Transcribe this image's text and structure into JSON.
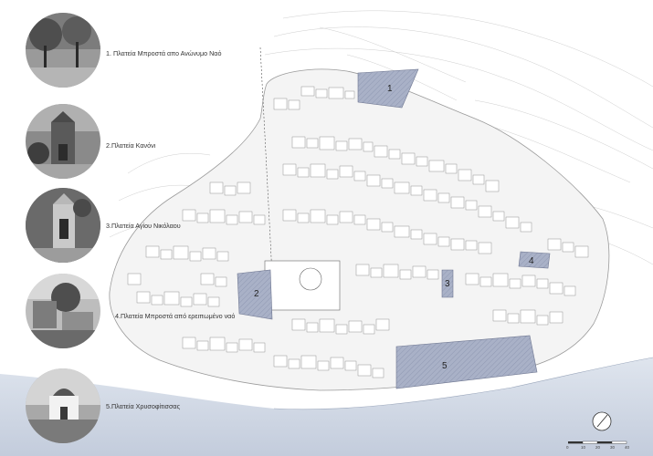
{
  "legend": [
    {
      "label": "1. Πλατεία Μπροστά απο Ανώνυμο Ναό"
    },
    {
      "label": "2.Πλατεία Κανόνι"
    },
    {
      "label": "3.Πλατεία Αγίου Νικόλαου"
    },
    {
      "label": "4.Πλατεία Μπροστά από ερειπωμένο ναό"
    },
    {
      "label": "5.Πλατεία Χρυσοφίτισσας"
    }
  ],
  "squares": [
    {
      "number": "1"
    },
    {
      "number": "2"
    },
    {
      "number": "3"
    },
    {
      "number": "4"
    },
    {
      "number": "5"
    }
  ],
  "scale_bar": {
    "ticks": [
      "0",
      "10",
      "20",
      "30",
      "40"
    ]
  },
  "colors": {
    "square_fill": "#a9b1c7",
    "sea": "#cdd5e3",
    "building_stroke": "#7a7a7a"
  },
  "icons": {
    "north": "north-arrow-icon"
  }
}
